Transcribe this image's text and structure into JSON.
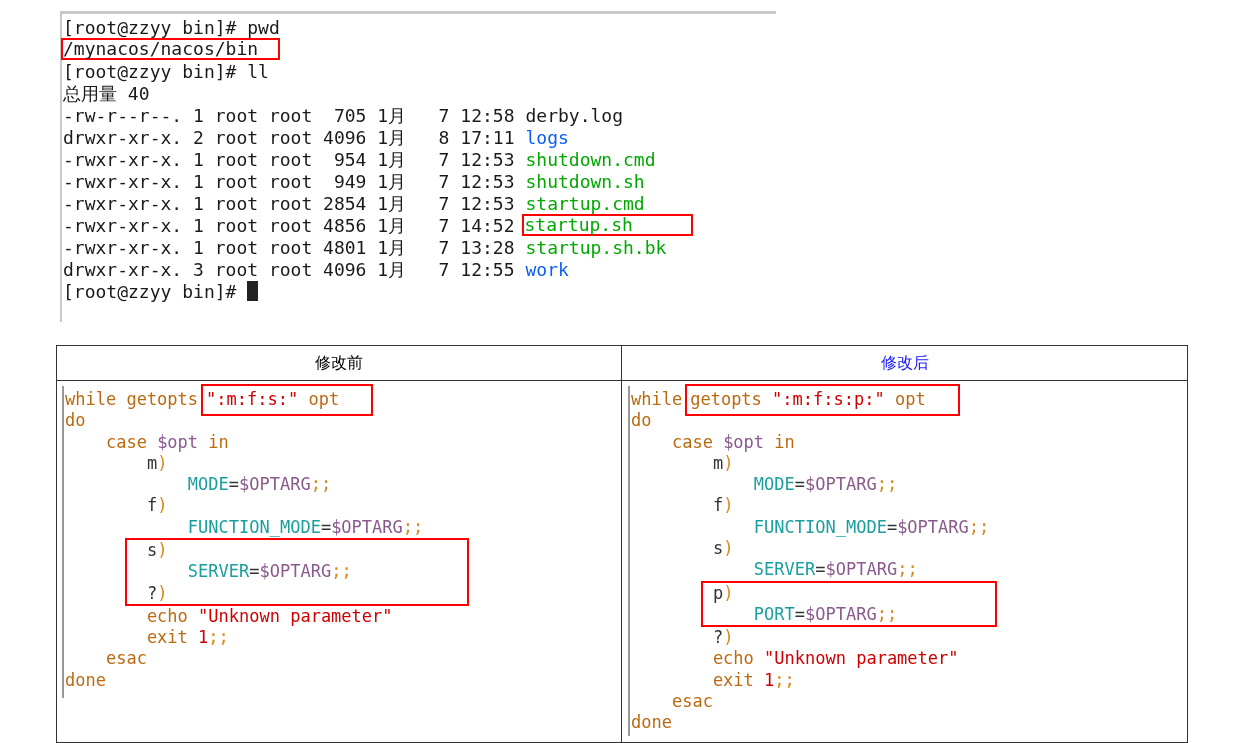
{
  "terminal": {
    "cursor_visible": true,
    "lines": [
      {
        "segments": [
          {
            "text": "[root@zzyy bin]# pwd",
            "kind": "plain",
            "boxed": false
          }
        ]
      },
      {
        "segments": [
          {
            "text": "/mynacos/nacos/bin",
            "kind": "plain",
            "boxed": true
          }
        ]
      },
      {
        "segments": [
          {
            "text": "[root@zzyy bin]# ll",
            "kind": "plain",
            "boxed": false
          }
        ]
      },
      {
        "segments": [
          {
            "text": "总用量 40",
            "kind": "plain",
            "boxed": false
          }
        ]
      },
      {
        "segments": [
          {
            "text": "-rw-r--r--. 1 root root  705 1月   7 12:58",
            "kind": "plain",
            "boxed": false
          },
          {
            "text": "derby.log",
            "kind": "plain",
            "boxed": false
          }
        ]
      },
      {
        "segments": [
          {
            "text": "drwxr-xr-x. 2 root root 4096 1月   8 17:11",
            "kind": "plain",
            "boxed": false
          },
          {
            "text": "logs",
            "kind": "dir",
            "boxed": false
          }
        ]
      },
      {
        "segments": [
          {
            "text": "-rwxr-xr-x. 1 root root  954 1月   7 12:53",
            "kind": "plain",
            "boxed": false
          },
          {
            "text": "shutdown.cmd",
            "kind": "exec",
            "boxed": false
          }
        ]
      },
      {
        "segments": [
          {
            "text": "-rwxr-xr-x. 1 root root  949 1月   7 12:53",
            "kind": "plain",
            "boxed": false
          },
          {
            "text": "shutdown.sh",
            "kind": "exec",
            "boxed": false
          }
        ]
      },
      {
        "segments": [
          {
            "text": "-rwxr-xr-x. 1 root root 2854 1月   7 12:53",
            "kind": "plain",
            "boxed": false
          },
          {
            "text": "startup.cmd",
            "kind": "exec",
            "boxed": false
          }
        ]
      },
      {
        "segments": [
          {
            "text": "-rwxr-xr-x. 1 root root 4856 1月   7 14:52",
            "kind": "plain",
            "boxed": false
          },
          {
            "text": "startup.sh",
            "kind": "exec",
            "boxed": true
          }
        ]
      },
      {
        "segments": [
          {
            "text": "-rwxr-xr-x. 1 root root 4801 1月   7 13:28",
            "kind": "plain",
            "boxed": false
          },
          {
            "text": "startup.sh.bk",
            "kind": "exec",
            "boxed": false
          }
        ]
      },
      {
        "segments": [
          {
            "text": "drwxr-xr-x. 3 root root 4096 1月   7 12:55",
            "kind": "plain",
            "boxed": false
          },
          {
            "text": "work",
            "kind": "dir",
            "boxed": false
          }
        ]
      },
      {
        "segments": [
          {
            "text": "[root@zzyy bin]#",
            "kind": "plain",
            "boxed": false
          }
        ]
      }
    ]
  },
  "comparison": {
    "columns": [
      {
        "title": "修改前",
        "color": "#000000",
        "blocks": [
          {
            "boxed": false,
            "lines": [
              {
                "segments": [
                  {
                    "boxed": false,
                    "tokens": [
                      {
                        "text": "while getopts",
                        "kind": "keyword"
                      }
                    ]
                  },
                  {
                    "boxed": true,
                    "tokens": [
                      {
                        "text": "\":m:f:s:\"",
                        "kind": "string"
                      },
                      {
                        "text": " opt",
                        "kind": "keyword"
                      }
                    ]
                  }
                ]
              },
              {
                "segments": [
                  {
                    "boxed": false,
                    "tokens": [
                      {
                        "text": "do",
                        "kind": "keyword"
                      }
                    ]
                  }
                ]
              },
              {
                "segments": [
                  {
                    "boxed": false,
                    "tokens": [
                      {
                        "text": "    case ",
                        "kind": "keyword"
                      },
                      {
                        "text": "$opt",
                        "kind": "variable"
                      },
                      {
                        "text": " in",
                        "kind": "keyword"
                      }
                    ]
                  }
                ]
              },
              {
                "segments": [
                  {
                    "boxed": false,
                    "tokens": [
                      {
                        "text": "        m",
                        "kind": "plain"
                      },
                      {
                        "text": ")",
                        "kind": "punct"
                      }
                    ]
                  }
                ]
              },
              {
                "segments": [
                  {
                    "boxed": false,
                    "tokens": [
                      {
                        "text": "            MODE",
                        "kind": "name"
                      },
                      {
                        "text": "=",
                        "kind": "plain"
                      },
                      {
                        "text": "$OPTARG",
                        "kind": "variable"
                      },
                      {
                        "text": ";;",
                        "kind": "punct"
                      }
                    ]
                  }
                ]
              },
              {
                "segments": [
                  {
                    "boxed": false,
                    "tokens": [
                      {
                        "text": "        f",
                        "kind": "plain"
                      },
                      {
                        "text": ")",
                        "kind": "punct"
                      }
                    ]
                  }
                ]
              },
              {
                "segments": [
                  {
                    "boxed": false,
                    "tokens": [
                      {
                        "text": "            FUNCTION_MODE",
                        "kind": "name"
                      },
                      {
                        "text": "=",
                        "kind": "plain"
                      },
                      {
                        "text": "$OPTARG",
                        "kind": "variable"
                      },
                      {
                        "text": ";;",
                        "kind": "punct"
                      }
                    ]
                  }
                ]
              }
            ]
          },
          {
            "boxed": true,
            "lines": [
              {
                "segments": [
                  {
                    "boxed": false,
                    "tokens": [
                      {
                        "text": "        s",
                        "kind": "plain"
                      },
                      {
                        "text": ")",
                        "kind": "punct"
                      }
                    ]
                  }
                ]
              },
              {
                "segments": [
                  {
                    "boxed": false,
                    "tokens": [
                      {
                        "text": "            SERVER",
                        "kind": "name"
                      },
                      {
                        "text": "=",
                        "kind": "plain"
                      },
                      {
                        "text": "$OPTARG",
                        "kind": "variable"
                      },
                      {
                        "text": ";;",
                        "kind": "punct"
                      }
                    ]
                  }
                ]
              },
              {
                "segments": [
                  {
                    "boxed": false,
                    "tokens": [
                      {
                        "text": "        ?",
                        "kind": "plain"
                      },
                      {
                        "text": ")",
                        "kind": "punct"
                      }
                    ]
                  }
                ]
              }
            ]
          },
          {
            "boxed": false,
            "lines": [
              {
                "segments": [
                  {
                    "boxed": false,
                    "tokens": [
                      {
                        "text": "        echo ",
                        "kind": "keyword"
                      },
                      {
                        "text": "\"Unknown parameter\"",
                        "kind": "string"
                      }
                    ]
                  }
                ]
              },
              {
                "segments": [
                  {
                    "boxed": false,
                    "tokens": [
                      {
                        "text": "        exit ",
                        "kind": "keyword"
                      },
                      {
                        "text": "1",
                        "kind": "string"
                      },
                      {
                        "text": ";;",
                        "kind": "punct"
                      }
                    ]
                  }
                ]
              },
              {
                "segments": [
                  {
                    "boxed": false,
                    "tokens": [
                      {
                        "text": "    esac",
                        "kind": "keyword"
                      }
                    ]
                  }
                ]
              },
              {
                "segments": [
                  {
                    "boxed": false,
                    "tokens": [
                      {
                        "text": "done",
                        "kind": "keyword"
                      }
                    ]
                  }
                ]
              }
            ]
          }
        ]
      },
      {
        "title": "修改后",
        "color": "#1a1aff",
        "blocks": [
          {
            "boxed": false,
            "lines": [
              {
                "segments": [
                  {
                    "boxed": false,
                    "tokens": [
                      {
                        "text": "while",
                        "kind": "keyword"
                      }
                    ]
                  },
                  {
                    "boxed": true,
                    "tokens": [
                      {
                        "text": "getopts ",
                        "kind": "keyword"
                      },
                      {
                        "text": "\":m:f:s:p:\"",
                        "kind": "string"
                      },
                      {
                        "text": " opt",
                        "kind": "keyword"
                      }
                    ]
                  }
                ]
              },
              {
                "segments": [
                  {
                    "boxed": false,
                    "tokens": [
                      {
                        "text": "do",
                        "kind": "keyword"
                      }
                    ]
                  }
                ]
              },
              {
                "segments": [
                  {
                    "boxed": false,
                    "tokens": [
                      {
                        "text": "    case ",
                        "kind": "keyword"
                      },
                      {
                        "text": "$opt",
                        "kind": "variable"
                      },
                      {
                        "text": " in",
                        "kind": "keyword"
                      }
                    ]
                  }
                ]
              },
              {
                "segments": [
                  {
                    "boxed": false,
                    "tokens": [
                      {
                        "text": "        m",
                        "kind": "plain"
                      },
                      {
                        "text": ")",
                        "kind": "punct"
                      }
                    ]
                  }
                ]
              },
              {
                "segments": [
                  {
                    "boxed": false,
                    "tokens": [
                      {
                        "text": "            MODE",
                        "kind": "name"
                      },
                      {
                        "text": "=",
                        "kind": "plain"
                      },
                      {
                        "text": "$OPTARG",
                        "kind": "variable"
                      },
                      {
                        "text": ";;",
                        "kind": "punct"
                      }
                    ]
                  }
                ]
              },
              {
                "segments": [
                  {
                    "boxed": false,
                    "tokens": [
                      {
                        "text": "        f",
                        "kind": "plain"
                      },
                      {
                        "text": ")",
                        "kind": "punct"
                      }
                    ]
                  }
                ]
              },
              {
                "segments": [
                  {
                    "boxed": false,
                    "tokens": [
                      {
                        "text": "            FUNCTION_MODE",
                        "kind": "name"
                      },
                      {
                        "text": "=",
                        "kind": "plain"
                      },
                      {
                        "text": "$OPTARG",
                        "kind": "variable"
                      },
                      {
                        "text": ";;",
                        "kind": "punct"
                      }
                    ]
                  }
                ]
              },
              {
                "segments": [
                  {
                    "boxed": false,
                    "tokens": [
                      {
                        "text": "        s",
                        "kind": "plain"
                      },
                      {
                        "text": ")",
                        "kind": "punct"
                      }
                    ]
                  }
                ]
              },
              {
                "segments": [
                  {
                    "boxed": false,
                    "tokens": [
                      {
                        "text": "            SERVER",
                        "kind": "name"
                      },
                      {
                        "text": "=",
                        "kind": "plain"
                      },
                      {
                        "text": "$OPTARG",
                        "kind": "variable"
                      },
                      {
                        "text": ";;",
                        "kind": "punct"
                      }
                    ]
                  }
                ]
              }
            ]
          },
          {
            "boxed": true,
            "lines": [
              {
                "segments": [
                  {
                    "boxed": false,
                    "tokens": [
                      {
                        "text": "        p",
                        "kind": "plain"
                      },
                      {
                        "text": ")",
                        "kind": "punct"
                      }
                    ]
                  }
                ]
              },
              {
                "segments": [
                  {
                    "boxed": false,
                    "tokens": [
                      {
                        "text": "            PORT",
                        "kind": "name"
                      },
                      {
                        "text": "=",
                        "kind": "plain"
                      },
                      {
                        "text": "$OPTARG",
                        "kind": "variable"
                      },
                      {
                        "text": ";;",
                        "kind": "punct"
                      }
                    ]
                  }
                ]
              }
            ]
          },
          {
            "boxed": false,
            "lines": [
              {
                "segments": [
                  {
                    "boxed": false,
                    "tokens": [
                      {
                        "text": "        ?",
                        "kind": "plain"
                      },
                      {
                        "text": ")",
                        "kind": "punct"
                      }
                    ]
                  }
                ]
              },
              {
                "segments": [
                  {
                    "boxed": false,
                    "tokens": [
                      {
                        "text": "        echo ",
                        "kind": "keyword"
                      },
                      {
                        "text": "\"Unknown parameter\"",
                        "kind": "string"
                      }
                    ]
                  }
                ]
              },
              {
                "segments": [
                  {
                    "boxed": false,
                    "tokens": [
                      {
                        "text": "        exit ",
                        "kind": "keyword"
                      },
                      {
                        "text": "1",
                        "kind": "string"
                      },
                      {
                        "text": ";;",
                        "kind": "punct"
                      }
                    ]
                  }
                ]
              },
              {
                "segments": [
                  {
                    "boxed": false,
                    "tokens": [
                      {
                        "text": "    esac",
                        "kind": "keyword"
                      }
                    ]
                  }
                ]
              },
              {
                "segments": [
                  {
                    "boxed": false,
                    "tokens": [
                      {
                        "text": "done",
                        "kind": "keyword"
                      }
                    ]
                  }
                ]
              }
            ]
          }
        ]
      }
    ]
  }
}
